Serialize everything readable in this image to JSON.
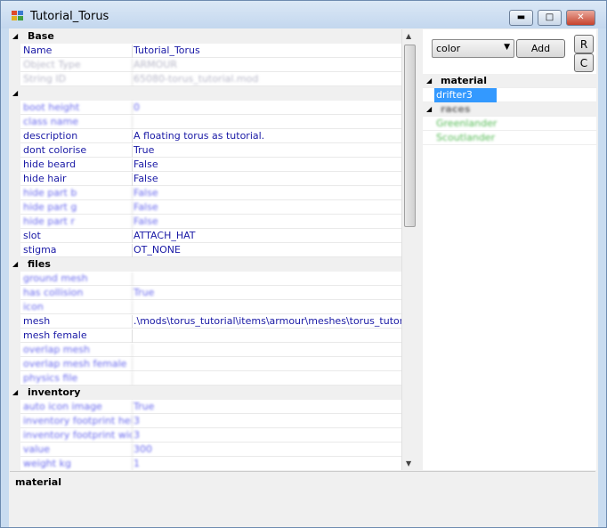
{
  "window": {
    "title": "Tutorial_Torus",
    "minimize": "0",
    "maximize": "1",
    "close": "r"
  },
  "grid": {
    "categories": [
      {
        "label": "Base",
        "rows": [
          {
            "key": "Name",
            "value": "Tutorial_Torus",
            "style": "normal"
          },
          {
            "key": "Object Type",
            "value": "ARMOUR",
            "style": "readonly"
          },
          {
            "key": "String ID",
            "value": "65080-torus_tutorial.mod",
            "style": "readonly"
          }
        ]
      },
      {
        "label": "",
        "rows": [
          {
            "key": "boot height",
            "value": "0",
            "style": "default"
          },
          {
            "key": "class name",
            "value": "",
            "style": "default"
          },
          {
            "key": "description",
            "value": "A floating torus as tutorial.",
            "style": "normal"
          },
          {
            "key": "dont colorise",
            "value": "True",
            "style": "normal"
          },
          {
            "key": "hide beard",
            "value": "False",
            "style": "normal"
          },
          {
            "key": "hide hair",
            "value": "False",
            "style": "normal"
          },
          {
            "key": "hide part b",
            "value": "False",
            "style": "default"
          },
          {
            "key": "hide part g",
            "value": "False",
            "style": "default"
          },
          {
            "key": "hide part r",
            "value": "False",
            "style": "default"
          },
          {
            "key": "slot",
            "value": "ATTACH_HAT",
            "style": "normal"
          },
          {
            "key": "stigma",
            "value": "OT_NONE",
            "style": "normal"
          }
        ]
      },
      {
        "label": "files",
        "rows": [
          {
            "key": "ground mesh",
            "value": "",
            "style": "default"
          },
          {
            "key": "has collision",
            "value": "True",
            "style": "default"
          },
          {
            "key": "icon",
            "value": "",
            "style": "default"
          },
          {
            "key": "mesh",
            "value": ".\\mods\\torus_tutorial\\items\\armour\\meshes\\torus_tutorial.mesh",
            "style": "normal"
          },
          {
            "key": "mesh female",
            "value": "",
            "style": "normal"
          },
          {
            "key": "overlap mesh",
            "value": "",
            "style": "default"
          },
          {
            "key": "overlap mesh female",
            "value": "",
            "style": "default"
          },
          {
            "key": "physics file",
            "value": "",
            "style": "default"
          }
        ]
      },
      {
        "label": "inventory",
        "rows": [
          {
            "key": "auto icon image",
            "value": "True",
            "style": "default"
          },
          {
            "key": "inventory footprint height",
            "value": "3",
            "style": "default"
          },
          {
            "key": "inventory footprint width",
            "value": "3",
            "style": "default"
          },
          {
            "key": "value",
            "value": "300",
            "style": "default"
          },
          {
            "key": "weight kg",
            "value": "1",
            "style": "default"
          }
        ]
      }
    ]
  },
  "description": {
    "title": "material"
  },
  "right": {
    "combo_value": "color",
    "add_label": "Add",
    "r_label": "R",
    "c_label": "C",
    "categories": [
      {
        "label": "material",
        "items": [
          "drifter3"
        ]
      },
      {
        "label": "races",
        "items": [
          "Greenlander",
          "Scoutlander"
        ]
      }
    ]
  },
  "colors": {
    "selection": "#3399ff",
    "default_value_text": "#6a6aee",
    "greyed_items": "#55bb55"
  }
}
